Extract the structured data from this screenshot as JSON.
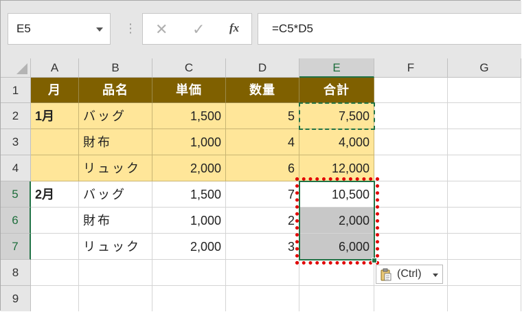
{
  "formula_bar": {
    "name_box": "E5",
    "separator": "⋮",
    "cancel_icon": "✕",
    "confirm_icon": "✓",
    "fx_label": "fx",
    "formula": "=C5*D5"
  },
  "columns": [
    "A",
    "B",
    "C",
    "D",
    "E",
    "F",
    "G"
  ],
  "rows": [
    "1",
    "2",
    "3",
    "4",
    "5",
    "6",
    "7",
    "8",
    "9"
  ],
  "table": {
    "headers": [
      "月",
      "品名",
      "単価",
      "数量",
      "合計"
    ],
    "data": [
      [
        "1月",
        "バッグ",
        "1,500",
        "5",
        "7,500"
      ],
      [
        "",
        "財布",
        "1,000",
        "4",
        "4,000"
      ],
      [
        "",
        "リュック",
        "2,000",
        "6",
        "12,000"
      ],
      [
        "2月",
        "バッグ",
        "1,500",
        "7",
        "10,500"
      ],
      [
        "",
        "財布",
        "1,000",
        "2",
        "2,000"
      ],
      [
        "",
        "リュック",
        "2,000",
        "3",
        "6,000"
      ]
    ]
  },
  "paste_options": {
    "label": "(Ctrl)",
    "icon": "clipboard-icon"
  },
  "colors": {
    "header_fill": "#7f6000",
    "header_text": "#ffffff",
    "row_fill_yellow": "#ffe699",
    "selection_green": "#217346",
    "highlight_red": "#e00000"
  }
}
